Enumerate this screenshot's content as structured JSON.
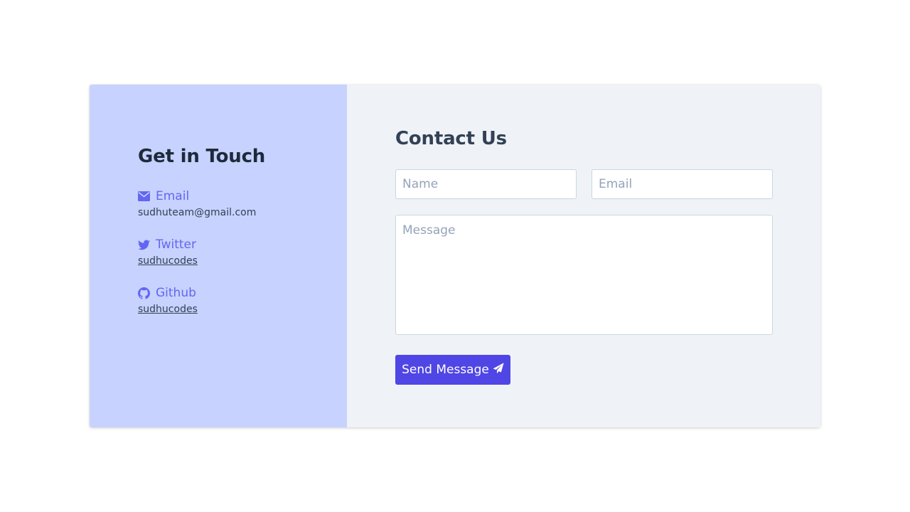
{
  "colors": {
    "left_panel_bg": "#c7d2fe",
    "right_panel_bg": "#eff3f8",
    "accent": "#6366f1",
    "button_bg": "#4f46e5",
    "heading": "#1e293b"
  },
  "info_panel": {
    "title": "Get in Touch",
    "items": [
      {
        "icon": "envelope-icon",
        "label": "Email",
        "value": "sudhuteam@gmail.com"
      },
      {
        "icon": "twitter-icon",
        "label": "Twitter",
        "value": "sudhucodes"
      },
      {
        "icon": "github-icon",
        "label": "Github",
        "value": "sudhucodes"
      }
    ]
  },
  "form": {
    "title": "Contact Us",
    "name_placeholder": "Name",
    "name_value": "",
    "email_placeholder": "Email",
    "email_value": "",
    "message_placeholder": "Message",
    "message_value": "",
    "submit_label": "Send Message",
    "submit_icon": "paper-plane-icon"
  }
}
